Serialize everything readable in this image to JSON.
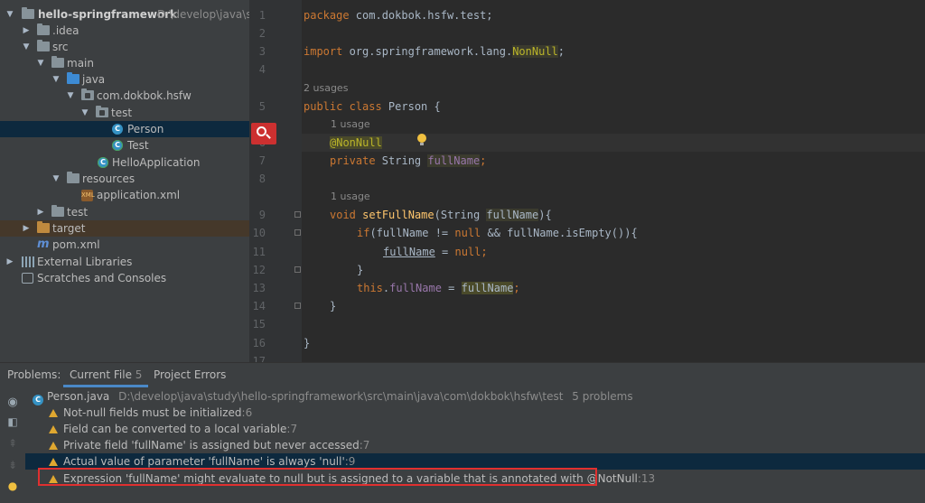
{
  "project_tree": {
    "root": {
      "name": "hello-springframework",
      "path": "D:\\develop\\java\\stu"
    },
    "items": [
      {
        "label": "hello-springframework"
      },
      {
        "label": ".idea"
      },
      {
        "label": "src"
      },
      {
        "label": "main"
      },
      {
        "label": "java"
      },
      {
        "label": "com.dokbok.hsfw"
      },
      {
        "label": "test"
      },
      {
        "label": "Person"
      },
      {
        "label": "Test"
      },
      {
        "label": "HelloApplication"
      },
      {
        "label": "resources"
      },
      {
        "label": "application.xml"
      },
      {
        "label": "test"
      },
      {
        "label": "target"
      },
      {
        "label": "pom.xml"
      },
      {
        "label": "External Libraries"
      },
      {
        "label": "Scratches and Consoles"
      }
    ]
  },
  "editor": {
    "line_numbers": [
      "1",
      "2",
      "3",
      "4",
      "5",
      "6",
      "7",
      "8",
      "9",
      "10",
      "11",
      "12",
      "13",
      "14",
      "15",
      "16",
      "17"
    ],
    "hints": {
      "two_usages": "2 usages",
      "one_usage_a": "1 usage",
      "one_usage_b": "1 usage"
    },
    "code": {
      "l1_kw": "package",
      "l1_rest": " com.dokbok.hsfw.test;",
      "l3_kw": "import",
      "l3_rest": " org.springframework.lang.",
      "l3_hl": "NonNull",
      "l3_end": ";",
      "l5_kw": "public class",
      "l5_rest": " Person {",
      "l6_ann": "@NonNull",
      "l7_kw": "private",
      "l7_rest": " String ",
      "l7_fld": "fullName",
      "l7_end": ";",
      "l9_kw": "void",
      "l9_fn": "setFullName",
      "l9_rest": "(String ",
      "l9_param": "fullName",
      "l9_end": "){",
      "l10_kw": "if",
      "l10_a": "(fullName != ",
      "l10_null": "null",
      "l10_b": " && fullName.isEmpty()){",
      "l11_var": "fullName",
      "l11_mid": " = ",
      "l11_null": "null",
      "l11_end": ";",
      "l12": "}",
      "l13_kw": "this",
      "l13_dot": ".",
      "l13_fld": "fullName",
      "l13_mid": " = ",
      "l13_param": "fullName",
      "l13_end": ";",
      "l14": "}",
      "l16": "}"
    }
  },
  "problems": {
    "label": "Problems:",
    "tabs": [
      {
        "label": "Current File",
        "count": "5"
      },
      {
        "label": "Project Errors"
      }
    ],
    "file": {
      "name": "Person.java",
      "path": "D:\\develop\\java\\study\\hello-springframework\\src\\main\\java\\com\\dokbok\\hsfw\\test",
      "summary": "5 problems"
    },
    "items": [
      {
        "text": "Not-null fields must be initialized",
        "line": ":6"
      },
      {
        "text": "Field can be converted to a local variable",
        "line": ":7"
      },
      {
        "text": "Private field 'fullName' is assigned but never accessed",
        "line": ":7"
      },
      {
        "text": "Actual value of parameter 'fullName' is always 'null'",
        "line": ":9"
      },
      {
        "text": "Expression 'fullName' might evaluate to null but is assigned to a variable that is annotated with @NotNull",
        "line": ":13"
      }
    ]
  },
  "colors": {
    "accent": "#4a88c7",
    "warning": "#e0a830",
    "highlight_box": "#e03030"
  }
}
